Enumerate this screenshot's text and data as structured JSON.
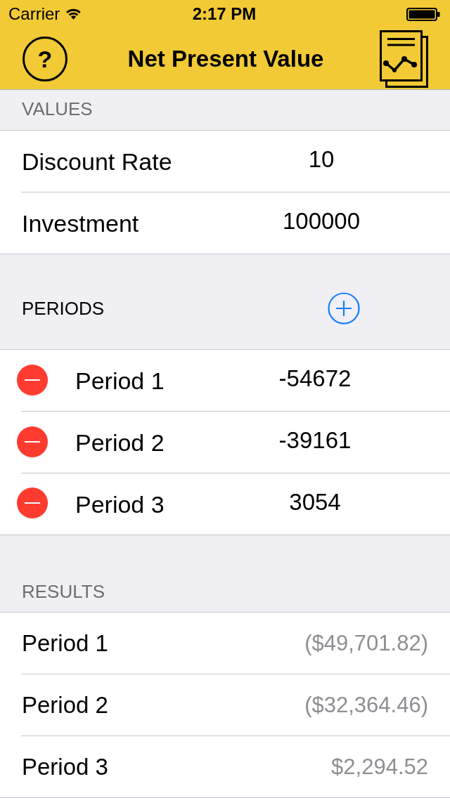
{
  "status_bar": {
    "carrier": "Carrier",
    "time": "2:17 PM"
  },
  "nav_bar": {
    "help_button": "?",
    "title": "Net Present Value"
  },
  "values": {
    "header": "VALUES",
    "rows": [
      {
        "label": "Discount Rate",
        "value": "10"
      },
      {
        "label": "Investment",
        "value": "100000"
      }
    ]
  },
  "periods": {
    "header": "PERIODS",
    "rows": [
      {
        "label": "Period 1",
        "value": "-54672"
      },
      {
        "label": "Period 2",
        "value": "-39161"
      },
      {
        "label": "Period 3",
        "value": "3054"
      }
    ]
  },
  "results": {
    "header": "RESULTS",
    "rows": [
      {
        "label": "Period 1",
        "value": "($49,701.82)"
      },
      {
        "label": "Period 2",
        "value": "($32,364.46)"
      },
      {
        "label": "Period 3",
        "value": "$2,294.52"
      }
    ]
  }
}
